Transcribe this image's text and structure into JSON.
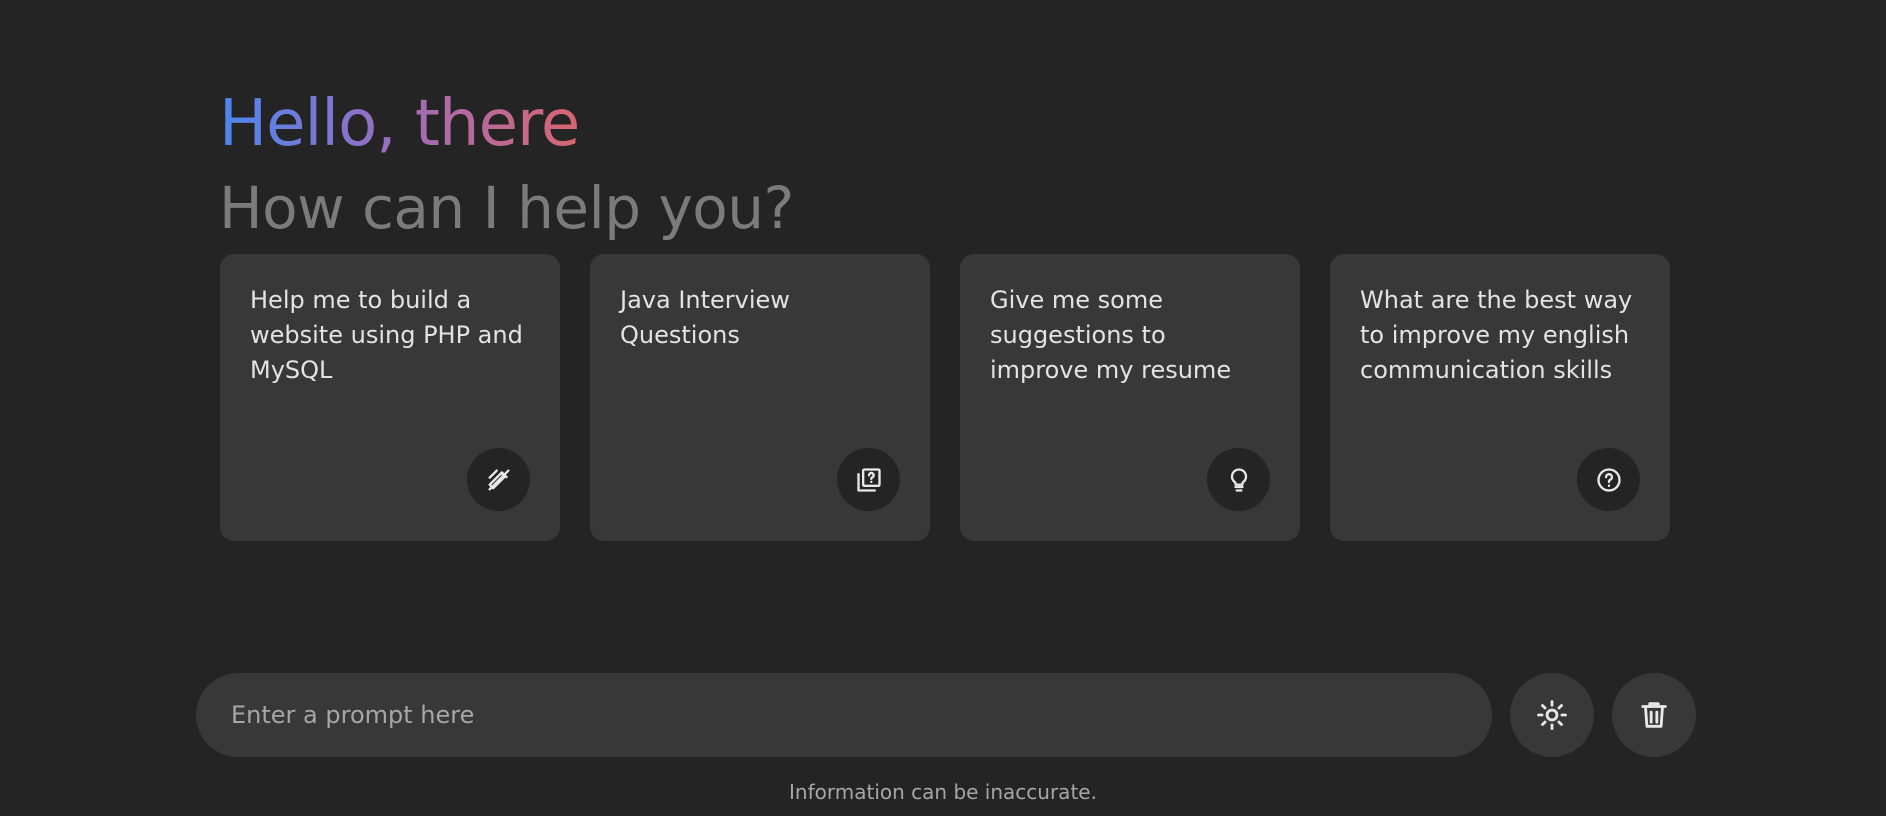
{
  "header": {
    "greeting": "Hello, there",
    "subtitle": "How can I help you?"
  },
  "suggestions": [
    {
      "text": "Help me to build a website using PHP and MySQL",
      "icon": "pencil-ruler-icon"
    },
    {
      "text": "Java Interview Questions",
      "icon": "quiz-icon"
    },
    {
      "text": "Give me some suggestions to improve my resume",
      "icon": "lightbulb-icon"
    },
    {
      "text": "What are the best way to improve my english communication skills",
      "icon": "help-circle-icon"
    }
  ],
  "prompt": {
    "placeholder": "Enter a prompt here",
    "value": ""
  },
  "buttons": {
    "theme_icon": "sun-icon",
    "delete_icon": "trash-icon"
  },
  "footer": {
    "disclaimer": "Information can be inaccurate."
  },
  "colors": {
    "background": "#242424",
    "card": "#383838",
    "gradient_start": "#4b86f0",
    "gradient_end": "#d96570",
    "subtitle": "#7b7b7b"
  }
}
